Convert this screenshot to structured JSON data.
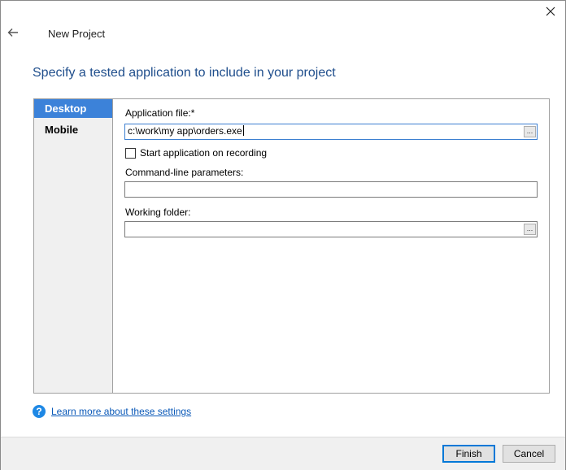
{
  "window": {
    "title": "New Project",
    "close_icon": "close-icon",
    "back_icon": "back-arrow-icon"
  },
  "heading": "Specify a tested application to include in your project",
  "sidebar": {
    "items": [
      {
        "label": "Desktop",
        "active": true
      },
      {
        "label": "Mobile",
        "active": false
      }
    ]
  },
  "form": {
    "application_file": {
      "label": "Application file:*",
      "value": "c:\\work\\my app\\orders.exe",
      "browse_label": "..."
    },
    "start_on_recording": {
      "label": "Start application on recording",
      "checked": false
    },
    "command_line": {
      "label": "Command-line parameters:",
      "value": ""
    },
    "working_folder": {
      "label": "Working folder:",
      "value": "",
      "browse_label": "..."
    }
  },
  "help": {
    "icon": "help-icon",
    "glyph": "?",
    "link": "Learn more about these settings"
  },
  "footer": {
    "finish": "Finish",
    "cancel": "Cancel"
  },
  "colors": {
    "accent": "#3c82d9",
    "heading": "#1f4e8c",
    "link": "#0b59b8"
  }
}
